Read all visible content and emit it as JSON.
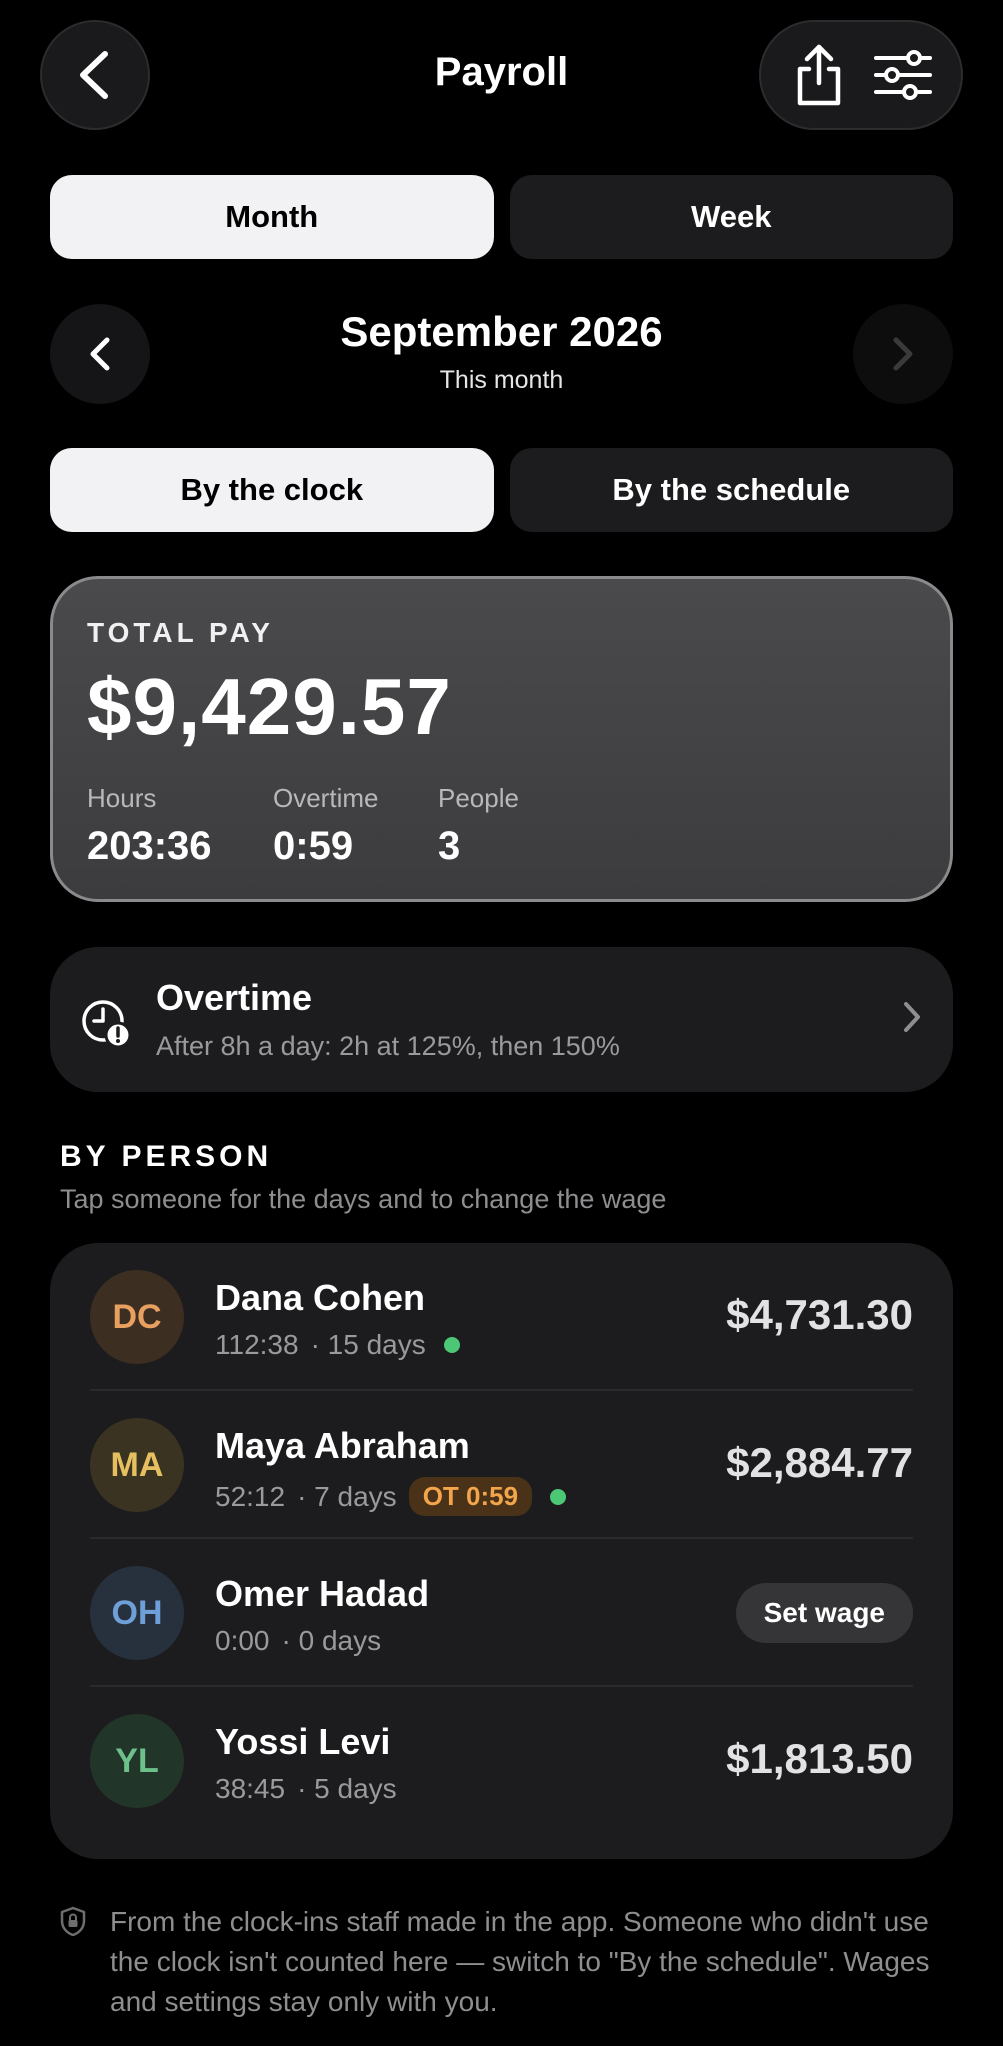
{
  "header": {
    "title": "Payroll"
  },
  "period_toggle": {
    "month_label": "Month",
    "week_label": "Week",
    "active": "month"
  },
  "month_nav": {
    "title": "September 2026",
    "subtitle": "This month"
  },
  "source_toggle": {
    "clock_label": "By the clock",
    "schedule_label": "By the schedule",
    "active": "clock"
  },
  "total": {
    "label": "TOTAL PAY",
    "value": "$9,429.57",
    "stats": [
      {
        "label": "Hours",
        "value": "203:36"
      },
      {
        "label": "Overtime",
        "value": "0:59"
      },
      {
        "label": "People",
        "value": "3"
      }
    ]
  },
  "overtime": {
    "title": "Overtime",
    "subtitle": "After 8h a day: 2h at 125%, then 150%"
  },
  "by_person": {
    "title": "BY PERSON",
    "subtitle": "Tap someone for the days and to change the wage",
    "people": [
      {
        "initials": "DC",
        "name": "Dana Cohen",
        "hours": "112:38",
        "days": "· 15 days",
        "amount": "$4,731.30",
        "ot": "",
        "active": true,
        "avatar_bg": "#3d2e22",
        "avatar_fg": "#e8a060"
      },
      {
        "initials": "MA",
        "name": "Maya Abraham",
        "hours": "52:12",
        "days": "· 7 days",
        "amount": "$2,884.77",
        "ot": "OT 0:59",
        "active": true,
        "avatar_bg": "#3a3322",
        "avatar_fg": "#e6c060"
      },
      {
        "initials": "OH",
        "name": "Omer Hadad",
        "hours": "0:00",
        "days": "· 0 days",
        "amount": "",
        "set_wage": "Set wage",
        "active": false,
        "avatar_bg": "#27303d",
        "avatar_fg": "#6f9fd8"
      },
      {
        "initials": "YL",
        "name": "Yossi Levi",
        "hours": "38:45",
        "days": "· 5 days",
        "amount": "$1,813.50",
        "ot": "",
        "active": false,
        "avatar_bg": "#223529",
        "avatar_fg": "#6ec08a"
      }
    ]
  },
  "footnote": "From the clock-ins staff made in the app. Someone who didn't use the clock isn't counted here — switch to \"By the schedule\". Wages and settings stay only with you."
}
